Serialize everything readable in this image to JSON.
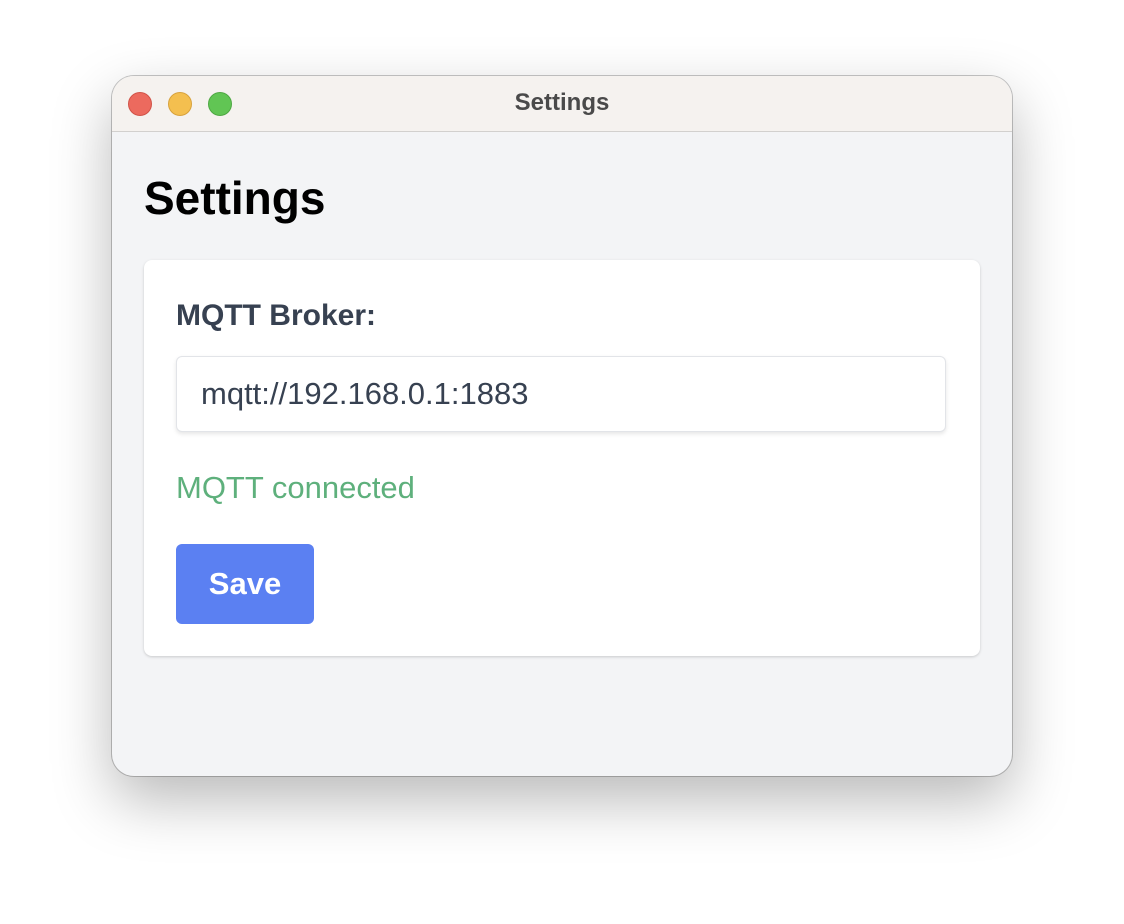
{
  "window": {
    "title": "Settings",
    "controls": {
      "close": "close",
      "minimize": "minimize",
      "zoom": "zoom"
    }
  },
  "page": {
    "title": "Settings"
  },
  "form": {
    "broker_label": "MQTT Broker:",
    "broker_value": "mqtt://192.168.0.1:1883",
    "status_text": "MQTT connected",
    "save_label": "Save"
  },
  "colors": {
    "status_connected": "#5eb07c",
    "save_button": "#5b80f2",
    "traffic_close": "#ec6a5e",
    "traffic_minimize": "#f4bf4f",
    "traffic_zoom": "#61c554"
  }
}
